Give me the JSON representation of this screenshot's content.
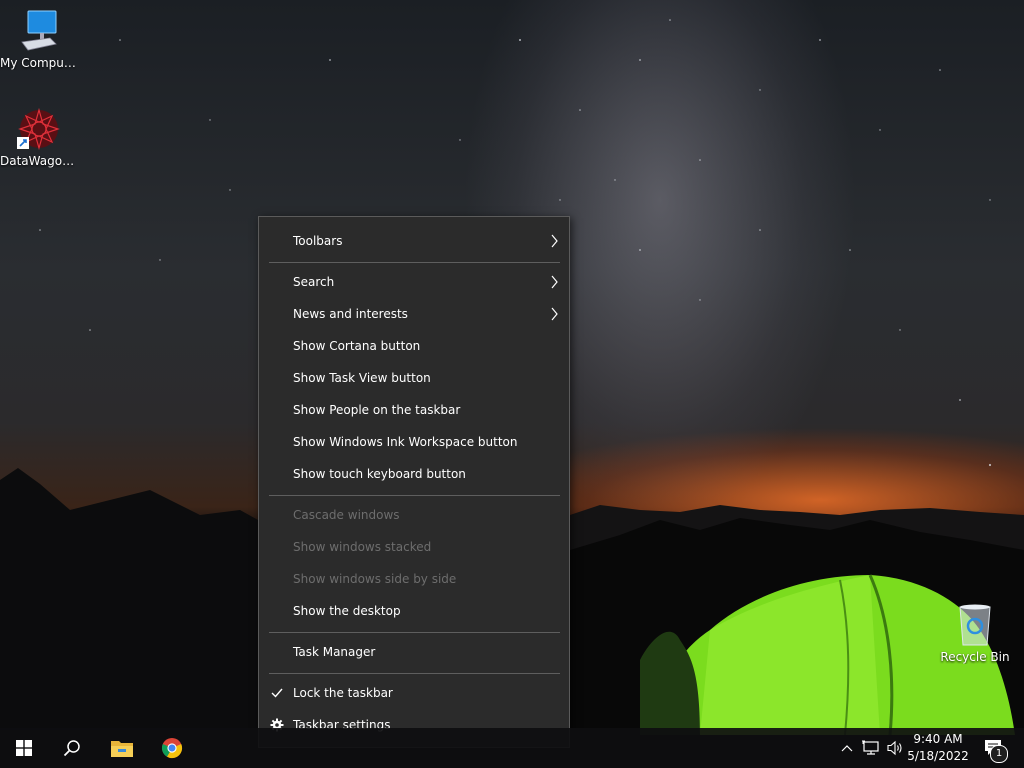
{
  "desktop": {
    "icons": [
      {
        "label": "My Computer"
      },
      {
        "label": "DataWagon..."
      },
      {
        "label": "Recycle Bin"
      }
    ]
  },
  "context_menu": {
    "items": [
      {
        "label": "Toolbars",
        "submenu": true
      },
      {
        "label": "Search",
        "submenu": true
      },
      {
        "label": "News and interests",
        "submenu": true
      },
      {
        "label": "Show Cortana button"
      },
      {
        "label": "Show Task View button"
      },
      {
        "label": "Show People on the taskbar"
      },
      {
        "label": "Show Windows Ink Workspace button"
      },
      {
        "label": "Show touch keyboard button"
      },
      {
        "label": "Cascade windows",
        "disabled": true
      },
      {
        "label": "Show windows stacked",
        "disabled": true
      },
      {
        "label": "Show windows side by side",
        "disabled": true
      },
      {
        "label": "Show the desktop"
      },
      {
        "label": "Task Manager"
      },
      {
        "label": "Lock the taskbar",
        "checked": true
      },
      {
        "label": "Taskbar settings",
        "icon": "gear-icon"
      }
    ]
  },
  "taskbar": {
    "pinned": [
      {
        "icon": "windows-start-icon"
      },
      {
        "icon": "search-icon"
      },
      {
        "icon": "file-explorer-icon"
      },
      {
        "icon": "chrome-icon"
      }
    ],
    "tray": {
      "icons": [
        "chevron-up-icon",
        "network-icon",
        "volume-icon"
      ],
      "time": "9:40 AM",
      "date": "5/18/2022",
      "notification_count": "1"
    }
  },
  "colors": {
    "menu_bg": "#2b2b2b",
    "menu_text": "#ffffff",
    "menu_disabled": "#6d6d6d",
    "separator": "#5e5e5e",
    "tent": "#7bdc1e"
  }
}
